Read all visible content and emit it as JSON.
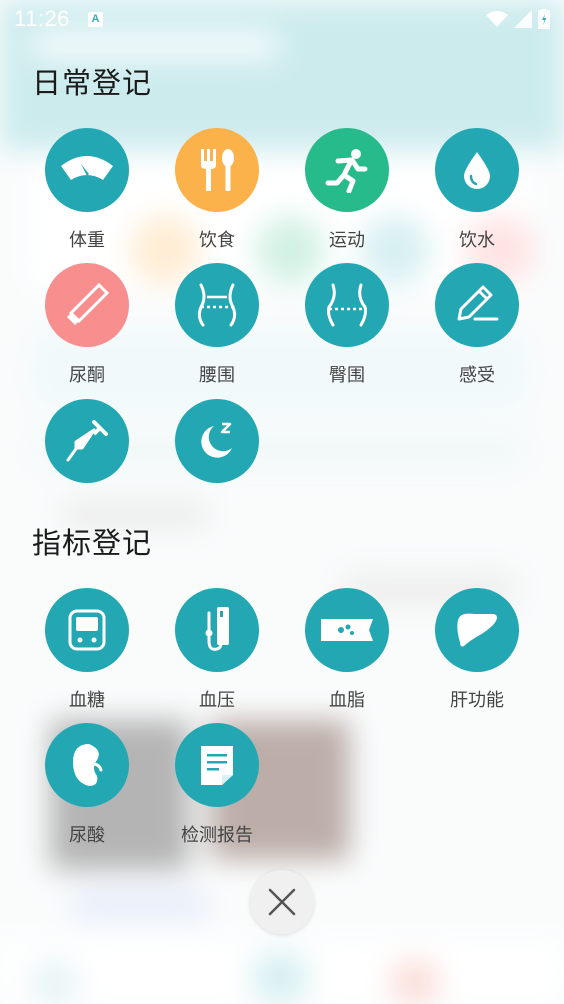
{
  "status_bar": {
    "time": "11:26",
    "notification_icon_letter": "A"
  },
  "colors": {
    "teal": "#23a8b3",
    "orange": "#fbb24a",
    "green": "#27bb8c",
    "pink": "#f88e8e",
    "close_bg": "#f0f0f0"
  },
  "daily_section": {
    "title": "日常登记",
    "items": [
      {
        "label": "体重",
        "icon": "scale-icon",
        "color": "#23a8b3"
      },
      {
        "label": "饮食",
        "icon": "fork-spoon-icon",
        "color": "#fbb24a"
      },
      {
        "label": "运动",
        "icon": "running-icon",
        "color": "#27bb8c"
      },
      {
        "label": "饮水",
        "icon": "water-drop-icon",
        "color": "#23a8b3"
      },
      {
        "label": "尿酮",
        "icon": "test-strip-icon",
        "color": "#f88e8e"
      },
      {
        "label": "腰围",
        "icon": "waist-icon",
        "color": "#23a8b3"
      },
      {
        "label": "臀围",
        "icon": "hip-icon",
        "color": "#23a8b3"
      },
      {
        "label": "感受",
        "icon": "pencil-note-icon",
        "color": "#23a8b3"
      },
      {
        "label": "",
        "icon": "syringe-icon",
        "color": "#23a8b3"
      },
      {
        "label": "",
        "icon": "sleep-moon-icon",
        "color": "#23a8b3"
      }
    ]
  },
  "indicator_section": {
    "title": "指标登记",
    "items": [
      {
        "label": "血糖",
        "icon": "glucose-meter-icon",
        "color": "#23a8b3"
      },
      {
        "label": "血压",
        "icon": "blood-pressure-icon",
        "color": "#23a8b3"
      },
      {
        "label": "血脂",
        "icon": "blood-vessel-icon",
        "color": "#23a8b3"
      },
      {
        "label": "肝功能",
        "icon": "liver-icon",
        "color": "#23a8b3"
      },
      {
        "label": "尿酸",
        "icon": "kidney-icon",
        "color": "#23a8b3"
      },
      {
        "label": "检测报告",
        "icon": "report-icon",
        "color": "#23a8b3"
      }
    ]
  },
  "close_button": {
    "icon": "close-icon"
  }
}
